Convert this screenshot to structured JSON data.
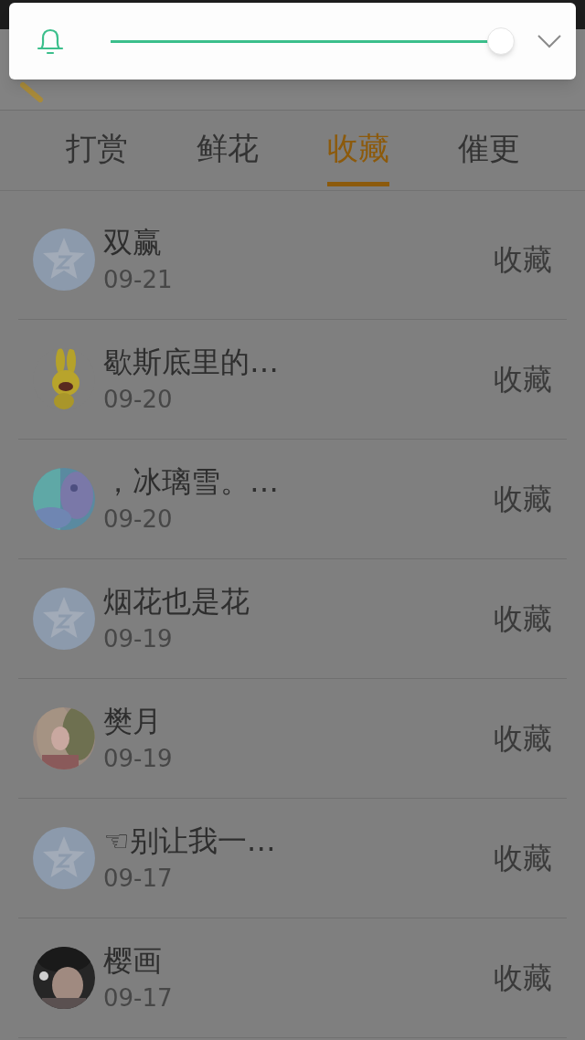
{
  "volume_popup": {
    "level": 0.97
  },
  "tabs": [
    {
      "label": "打赏",
      "selected": false
    },
    {
      "label": "鲜花",
      "selected": false
    },
    {
      "label": "收藏",
      "selected": true
    },
    {
      "label": "催更",
      "selected": false
    }
  ],
  "rows": [
    {
      "avatar": {
        "kind": "default"
      },
      "name": "双赢",
      "date": "09-21",
      "action": "收藏"
    },
    {
      "name": "歇斯底里的…",
      "date": "09-20",
      "action": "收藏"
    },
    {
      "name": "，冰璃雪。…",
      "date": "09-20",
      "action": "收藏"
    },
    {
      "avatar": {
        "kind": "default"
      },
      "name": "烟花也是花",
      "date": "09-19",
      "action": "收藏"
    },
    {
      "name": "樊月",
      "date": "09-19",
      "action": "收藏"
    },
    {
      "avatar": {
        "kind": "default"
      },
      "name": "☜别让我一…",
      "date": "09-17",
      "action": "收藏"
    },
    {
      "name": "樱画",
      "date": "09-17",
      "action": "收藏"
    }
  ]
}
